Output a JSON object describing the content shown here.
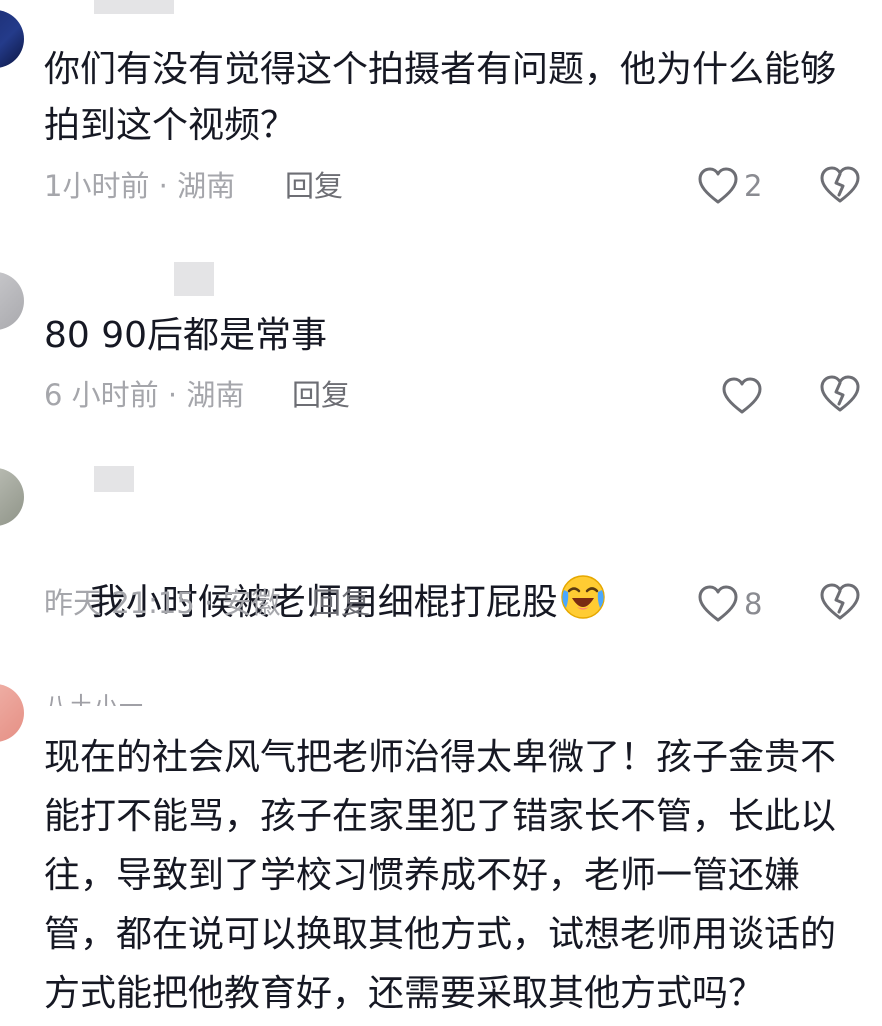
{
  "comments": [
    {
      "text": "你们有没有觉得这个拍摄者有问题，他为什么能够拍到这个视频？",
      "time_location": "1小时前 · 湖南",
      "reply_label": "回复",
      "like_count": "2"
    },
    {
      "text": "80 90后都是常事",
      "time_location": "6 小时前 · 湖南",
      "reply_label": "回复",
      "like_count": ""
    },
    {
      "text": "我小时候被老师用细棍打屁股",
      "time_location": "昨天 21:15 · 安徽",
      "reply_label": "回复",
      "like_count": "8"
    },
    {
      "username": "八土小一",
      "text": "现在的社会风气把老师治得太卑微了！孩子金贵不能打不能骂，孩子在家里犯了错家长不管，长此以往，导致到了学校习惯养成不好，老师一管还嫌管，都在说可以换取其他方式，试想老师用谈话的方式能把他教育好，还需要采取其他方式吗？"
    }
  ],
  "icons": {
    "like": "heart-outline-icon",
    "dislike": "broken-heart-icon",
    "emoji": "crying-laughing-emoji"
  }
}
